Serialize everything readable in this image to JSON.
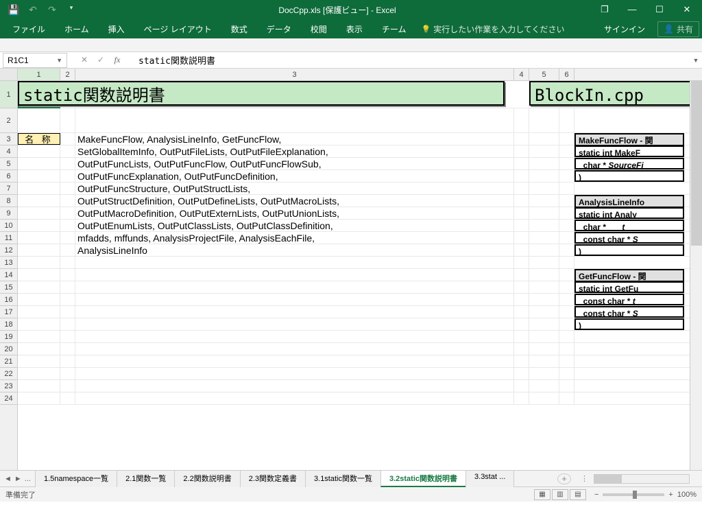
{
  "titlebar": {
    "title": "DocCpp.xls  [保護ビュー] - Excel"
  },
  "win": {
    "restore": "❐",
    "min": "—",
    "max": "☐",
    "close": "✕"
  },
  "qat": {
    "save": "💾",
    "undo": "↶",
    "redo": "↷",
    "custom": "▾"
  },
  "ribbon": {
    "tabs": [
      "ファイル",
      "ホーム",
      "挿入",
      "ページ レイアウト",
      "数式",
      "データ",
      "校閲",
      "表示",
      "チーム"
    ],
    "tellme": "実行したい作業を入力してください",
    "signin": "サインイン",
    "share": "共有"
  },
  "fbar": {
    "ref": "R1C1",
    "cancel": "✕",
    "enter": "✓",
    "fx": "fx",
    "formula": "static関数説明書"
  },
  "cols": {
    "c1": "1",
    "c2": "2",
    "c3": "3",
    "c4": "4",
    "c5": "5",
    "c6": "6"
  },
  "sheet": {
    "title_left": "static関数説明書",
    "title_right": "BlockIn.cpp",
    "name_label": "名 称",
    "lines": [
      "MakeFuncFlow, AnalysisLineInfo, GetFuncFlow,",
      "SetGlobalItemInfo, OutPutFileLists, OutPutFileExplanation,",
      "OutPutFuncLists, OutPutFuncFlow, OutPutFuncFlowSub,",
      "OutPutFuncExplanation, OutPutFuncDefinition,",
      "OutPutFuncStructure, OutPutStructLists,",
      "OutPutStructDefinition, OutPutDefineLists, OutPutMacroLists,",
      "OutPutMacroDefinition, OutPutExternLists, OutPutUnionLists,",
      "OutPutEnumLists, OutPutClassLists, OutPutClassDefinition,",
      "mfadds, mffunds, AnalysisProjectFile, AnalysisEachFile,",
      "AnalysisLineInfo"
    ],
    "code1": {
      "title": "MakeFuncFlow - 関",
      "l1": "static int MakeF",
      "l2": "  char * SourceFi",
      "l3": ")"
    },
    "code2": {
      "title": "AnalysisLineInfo",
      "l1": "static int Analy",
      "l2": "  char *       t",
      "l3": "  const char * S",
      "l4": ")"
    },
    "code3": {
      "title": "GetFuncFlow - 関",
      "l1": "static int GetFu",
      "l2": "  const char * t",
      "l3": "  const char * S",
      "l4": ")"
    }
  },
  "tabs": {
    "ellipsis": "...",
    "items": [
      "1.5namespace一覧",
      "2.1関数一覧",
      "2.2関数説明書",
      "2.3関数定義書",
      "3.1static関数一覧",
      "3.2static関数説明書",
      "3.3stat ..."
    ],
    "active": 5
  },
  "status": {
    "ready": "準備完了",
    "zoom": "100%"
  }
}
